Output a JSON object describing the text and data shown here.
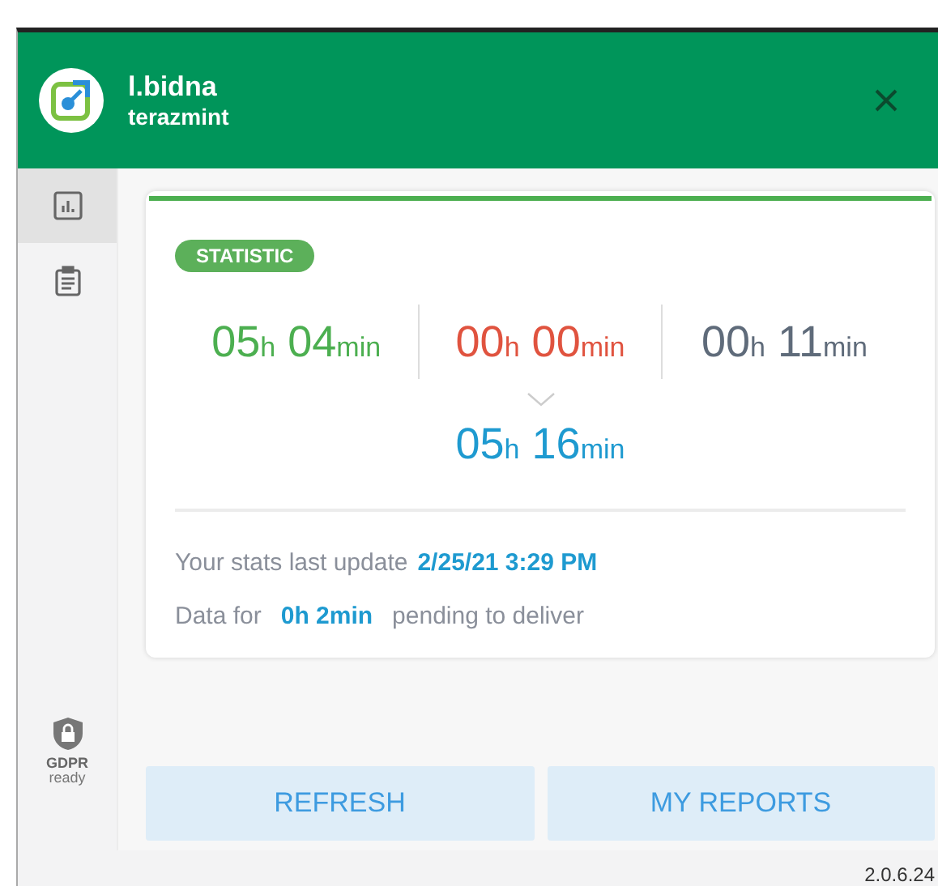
{
  "header": {
    "title": "l.bidna",
    "subtitle": "terazmint"
  },
  "sidebar": {
    "items": [
      {
        "kind": "stats",
        "selected": true
      },
      {
        "kind": "reports",
        "selected": false
      }
    ],
    "badge": {
      "title": "GDPR",
      "subtitle": "ready"
    }
  },
  "card": {
    "tag": "STATISTIC",
    "times": [
      {
        "hours": "05",
        "hours_unit": "h",
        "minutes": "04",
        "minutes_unit": "min",
        "color": "#4caf50"
      },
      {
        "hours": "00",
        "hours_unit": "h",
        "minutes": "00",
        "minutes_unit": "min",
        "color": "#e0533f"
      },
      {
        "hours": "00",
        "hours_unit": "h",
        "minutes": "11",
        "minutes_unit": "min",
        "color": "#5f6b7a"
      }
    ],
    "total": {
      "hours": "05",
      "hours_unit": "h",
      "minutes": "16",
      "minutes_unit": "min",
      "color": "#1e9ad0"
    },
    "last_update": {
      "label": "Your stats last update",
      "value": "2/25/21 3:29 PM"
    },
    "pending": {
      "label": "Data for",
      "value": "0h 2min",
      "suffix": "pending to deliver"
    }
  },
  "buttons": [
    "REFRESH",
    "MY REPORTS"
  ],
  "version": "2.0.6.24"
}
